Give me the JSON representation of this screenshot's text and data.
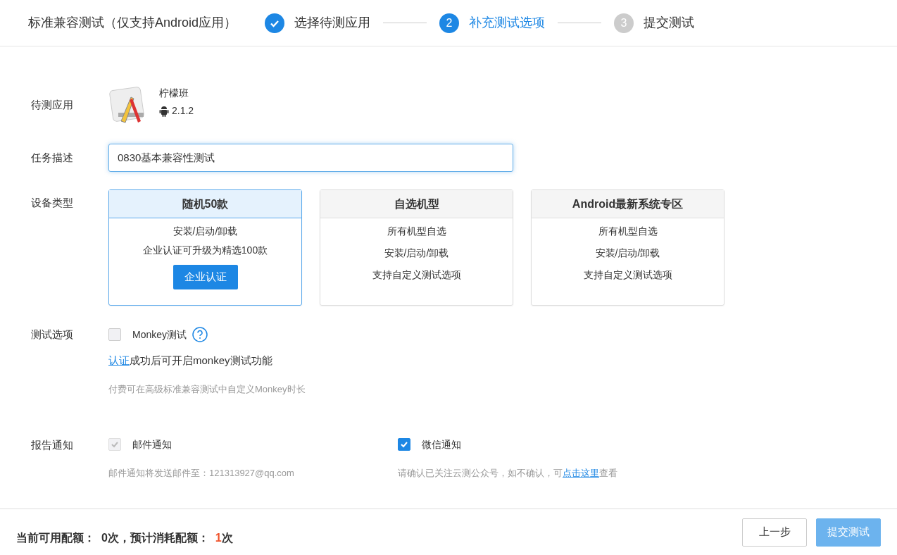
{
  "header": {
    "title": "标准兼容测试（仅支持Android应用）",
    "steps": [
      {
        "label": "选择待测应用",
        "done": true,
        "selected": false
      },
      {
        "marker": "2",
        "label": "补充测试选项",
        "done": false,
        "selected": true
      },
      {
        "marker": "3",
        "label": "提交测试",
        "done": false,
        "selected": false
      }
    ]
  },
  "app": {
    "label": "待测应用",
    "name": "柠檬班",
    "version": "2.1.2"
  },
  "task": {
    "label": "任务描述",
    "value": "0830基本兼容性测试"
  },
  "devices": {
    "label": "设备类型",
    "cards": [
      {
        "title": "随机50款",
        "selected": true,
        "lines": [
          "安装/启动/卸载",
          "企业认证可升级为精选100款"
        ],
        "button": "企业认证"
      },
      {
        "title": "自选机型",
        "selected": false,
        "lines": [
          "所有机型自选",
          "安装/启动/卸载",
          "支持自定义测试选项"
        ]
      },
      {
        "title": "Android最新系统专区",
        "selected": false,
        "lines": [
          "所有机型自选",
          "安装/启动/卸载",
          "支持自定义测试选项"
        ]
      }
    ]
  },
  "options": {
    "label": "测试选项",
    "monkey": {
      "label": "Monkey测试",
      "checked": false,
      "disabled": true
    },
    "note": {
      "link": "认证",
      "text": "成功后可开启monkey测试功能"
    },
    "hint": "付费可在高级标准兼容测试中自定义Monkey时长"
  },
  "notify": {
    "label": "报告通知",
    "items": [
      {
        "label": "邮件通知",
        "checked": true,
        "disabled": true,
        "note": {
          "before": "邮件通知将发送邮件至：121313927@qq.com"
        }
      },
      {
        "label": "微信通知",
        "checked": true,
        "disabled": false,
        "note": {
          "before": "请确认已关注云测公众号，如不确认，可",
          "link": "点击这里",
          "after": "查看"
        }
      }
    ]
  },
  "footer": {
    "quota": {
      "before": "当前可用配额：  0次，预计消耗配额：  ",
      "highlight": "1",
      "after": "次"
    },
    "buttons": [
      {
        "label": "上一步",
        "kind": "secondary"
      },
      {
        "label": "提交测试",
        "kind": "primary",
        "disabled": true
      }
    ]
  }
}
